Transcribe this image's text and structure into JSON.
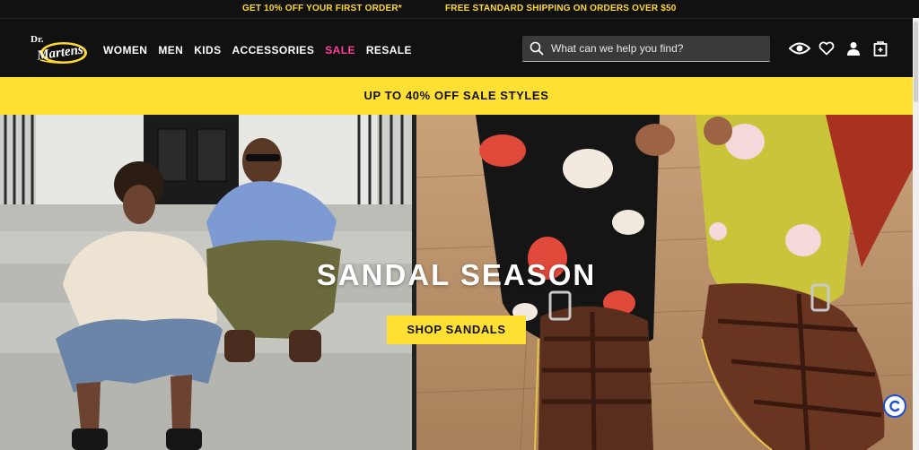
{
  "promo": {
    "first_order": "GET 10% OFF YOUR FIRST ORDER*",
    "shipping": "FREE STANDARD SHIPPING ON ORDERS OVER $50"
  },
  "brand": {
    "logo_text": "Dr. Martens"
  },
  "nav": {
    "items": [
      {
        "label": "WOMEN"
      },
      {
        "label": "MEN"
      },
      {
        "label": "KIDS"
      },
      {
        "label": "ACCESSORIES"
      },
      {
        "label": "SALE"
      },
      {
        "label": "RESALE"
      }
    ]
  },
  "search": {
    "placeholder": "What can we help you find?"
  },
  "utility_icons": [
    "eye-icon",
    "heart-icon",
    "account-icon",
    "bag-icon"
  ],
  "sale_banner": {
    "text": "UP TO 40% OFF SALE STYLES"
  },
  "hero": {
    "title": "SANDAL SEASON",
    "cta_label": "SHOP SANDALS"
  },
  "colors": {
    "accent_yellow": "#ffe033",
    "sale_pink": "#ff3d9a",
    "header_bg": "#111111"
  }
}
